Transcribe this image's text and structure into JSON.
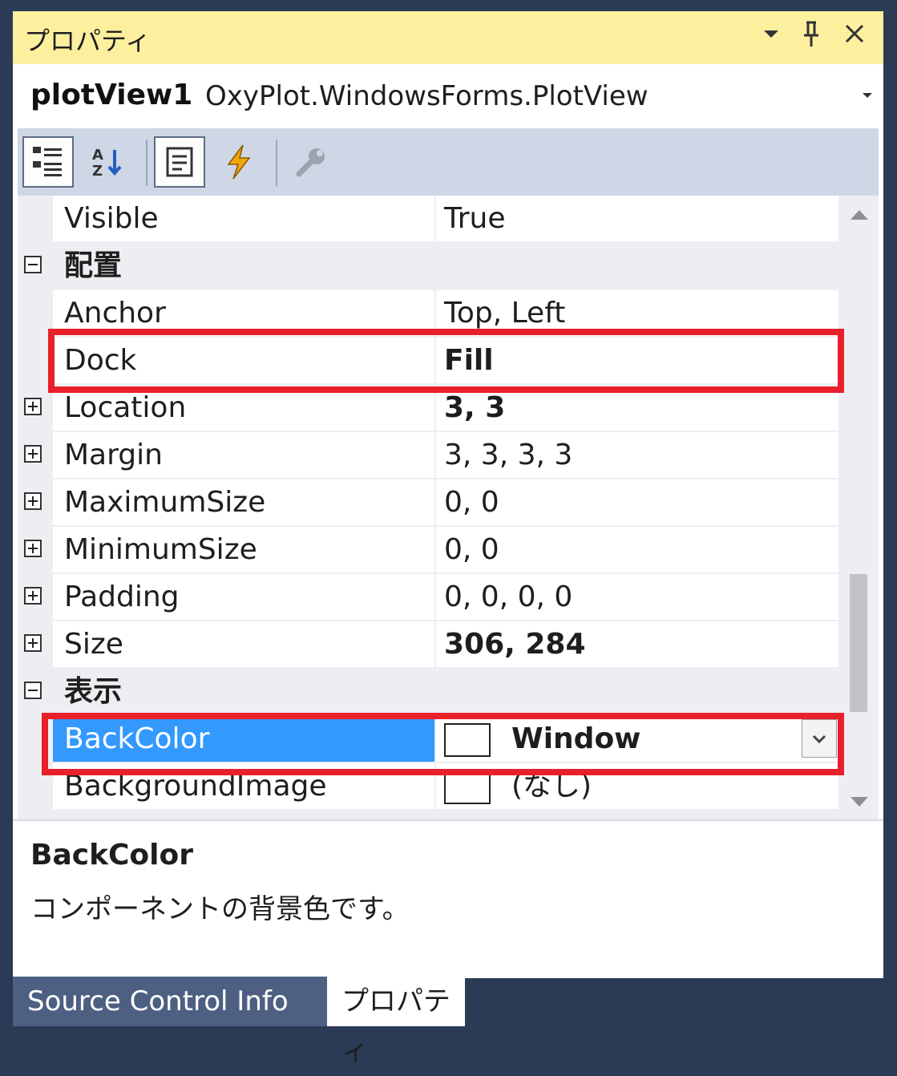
{
  "window": {
    "title": "プロパティ",
    "buttons": {
      "dropdown": "▾",
      "pin": "🖈",
      "close": "✕"
    }
  },
  "object_selector": {
    "name": "plotView1",
    "type": "OxyPlot.WindowsForms.PlotView",
    "dropdown": "▾"
  },
  "toolbar": {
    "items": [
      {
        "icon": "categorized-icon",
        "pressed": true
      },
      {
        "icon": "alphabetical-sort-icon",
        "pressed": false
      },
      {
        "icon": "properties-page-icon",
        "pressed": true
      },
      {
        "icon": "events-lightning-icon",
        "pressed": false
      },
      {
        "icon": "property-pages-wrench-icon",
        "pressed": false
      }
    ]
  },
  "grid": {
    "rows": [
      {
        "kind": "prop",
        "name": "Visible",
        "value": "True"
      },
      {
        "kind": "category",
        "name": "配置"
      },
      {
        "kind": "prop",
        "name": "Anchor",
        "value": "Top, Left"
      },
      {
        "kind": "prop",
        "name": "Dock",
        "value": "Fill"
      },
      {
        "kind": "prop",
        "name": "Location",
        "value": "3, 3"
      },
      {
        "kind": "prop",
        "name": "Margin",
        "value": "3, 3, 3, 3"
      },
      {
        "kind": "prop",
        "name": "MaximumSize",
        "value": "0, 0"
      },
      {
        "kind": "prop",
        "name": "MinimumSize",
        "value": "0, 0"
      },
      {
        "kind": "prop",
        "name": "Padding",
        "value": "0, 0, 0, 0"
      },
      {
        "kind": "prop",
        "name": "Size",
        "value": "306, 284"
      },
      {
        "kind": "category",
        "name": "表示"
      },
      {
        "kind": "prop",
        "name": "BackColor",
        "value": "Window"
      },
      {
        "kind": "prop",
        "name": "BackgroundImage",
        "value": "(なし)"
      }
    ]
  },
  "description": {
    "title": "BackColor",
    "text": "コンポーネントの背景色です。"
  },
  "tabs": [
    {
      "label": "Source Control Info",
      "active": false
    },
    {
      "label": "プロパティ",
      "active": true
    }
  ],
  "colors": {
    "title_bar": "#fcef9e",
    "selection": "#3399ff",
    "highlight_box": "#e8202a",
    "tab_inactive": "#4d6082"
  }
}
